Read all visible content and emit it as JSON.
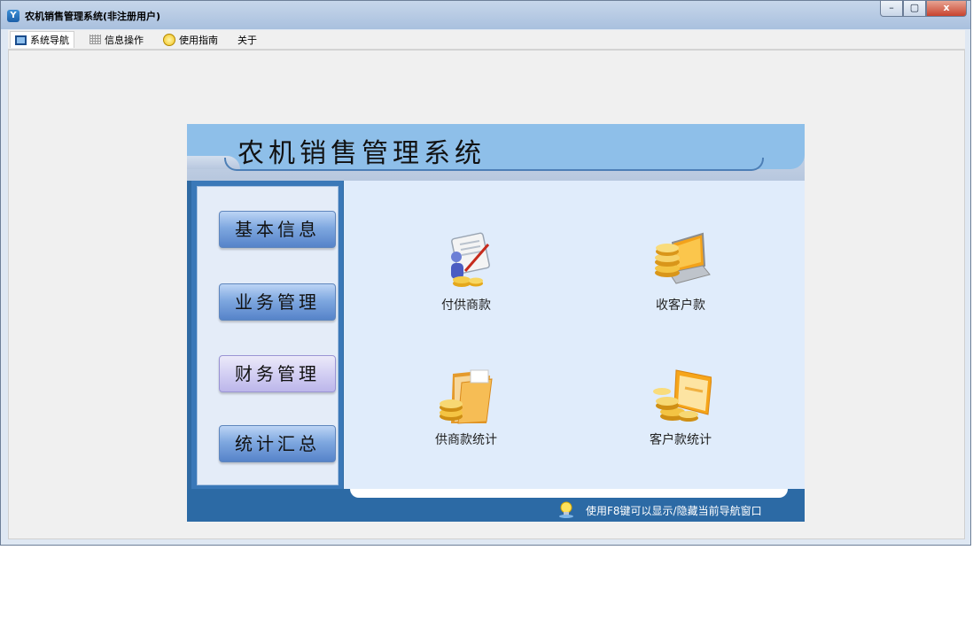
{
  "window": {
    "title": "农机销售管理系统(非注册用户)",
    "controls": {
      "minimize": "–",
      "restore": "▢",
      "close": "x"
    }
  },
  "menubar": {
    "tabs": [
      {
        "label": "系统导航",
        "icon": "monitor-icon",
        "selected": true
      },
      {
        "label": "信息操作",
        "icon": "grid-icon",
        "selected": false
      },
      {
        "label": "使用指南",
        "icon": "bulb-icon",
        "selected": false
      },
      {
        "label": "关于",
        "icon": "",
        "selected": false
      }
    ]
  },
  "nav_panel": {
    "title": "农机销售管理系统",
    "left_buttons": [
      {
        "label": "基本信息",
        "active": false
      },
      {
        "label": "业务管理",
        "active": false
      },
      {
        "label": "财务管理",
        "active": true
      },
      {
        "label": "统计汇总",
        "active": false
      }
    ],
    "items": [
      {
        "label": "付供商款",
        "icon": "payment-document-icon"
      },
      {
        "label": "收客户款",
        "icon": "coins-laptop-icon"
      },
      {
        "label": "供商款统计",
        "icon": "folder-coins-icon"
      },
      {
        "label": "客户款统计",
        "icon": "card-coins-icon"
      }
    ],
    "footer_tip": "使用F8键可以显示/隐藏当前导航窗口"
  },
  "colors": {
    "panel_blue": "#2f6aa3",
    "header_blue": "#8ebfe9",
    "content_bg": "#e0ecfb"
  }
}
